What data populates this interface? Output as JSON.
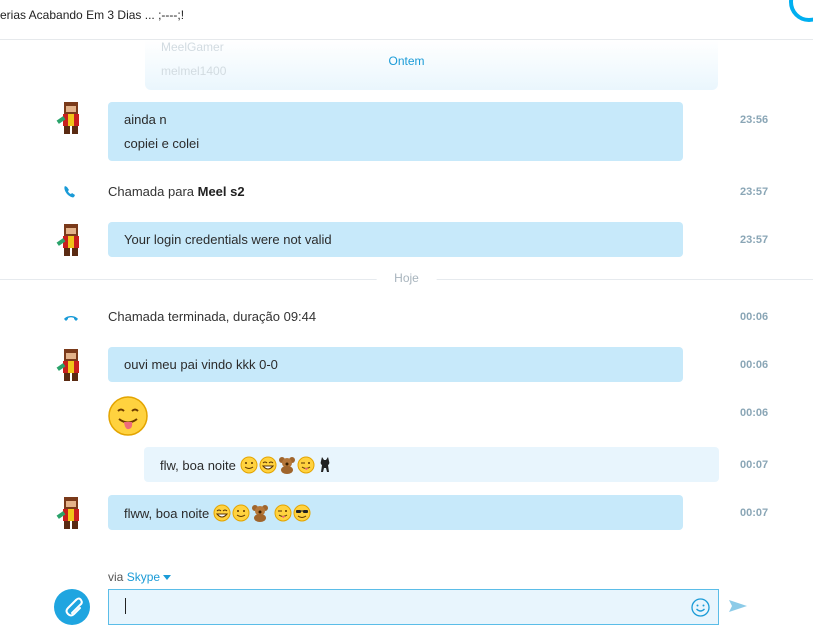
{
  "window": {
    "title": "erias Acabando Em 3 Dias ... ;----;!"
  },
  "faded_message": {
    "line1": "MeelGamer",
    "line2": "melmel1400"
  },
  "dates": {
    "yesterday": "Ontem",
    "today": "Hoje"
  },
  "messages": [
    {
      "lines": [
        "ainda n",
        "copiei e colei"
      ],
      "time": "23:56"
    },
    {
      "call_prefix": "Chamada para ",
      "call_name": "Meel s2",
      "time": "23:57"
    },
    {
      "lines": [
        "Your login credentials were not valid"
      ],
      "time": "23:57"
    },
    {
      "call_text": "Chamada terminada, duração 09:44",
      "time": "00:06"
    },
    {
      "lines": [
        "ouvi meu pai vindo kkk 0-0"
      ],
      "time": "00:06"
    },
    {
      "emoji": "tongue-face",
      "time": "00:06"
    },
    {
      "text": "flw, boa noite",
      "emojis": [
        "smile",
        "grin",
        "teddy-bear",
        "tongue-wink",
        "cat"
      ],
      "time": "00:07"
    },
    {
      "text": "flww, boa noite",
      "emojis": [
        "grin",
        "smile",
        "teddy-bear",
        "tongue-wink",
        "sunglasses"
      ],
      "time": "00:07"
    }
  ],
  "composer": {
    "via_label": "via ",
    "via_service": "Skype",
    "value": "",
    "placeholder": ""
  },
  "colors": {
    "accent": "#00aff0",
    "bubble_in": "#c7e9fa",
    "bubble_out": "#e8f5fd",
    "timestamp": "#8aa6b6"
  },
  "icons": [
    "avatar",
    "phone-icon",
    "phone-hangup-icon",
    "attach-icon",
    "emoticon-icon",
    "send-icon"
  ]
}
